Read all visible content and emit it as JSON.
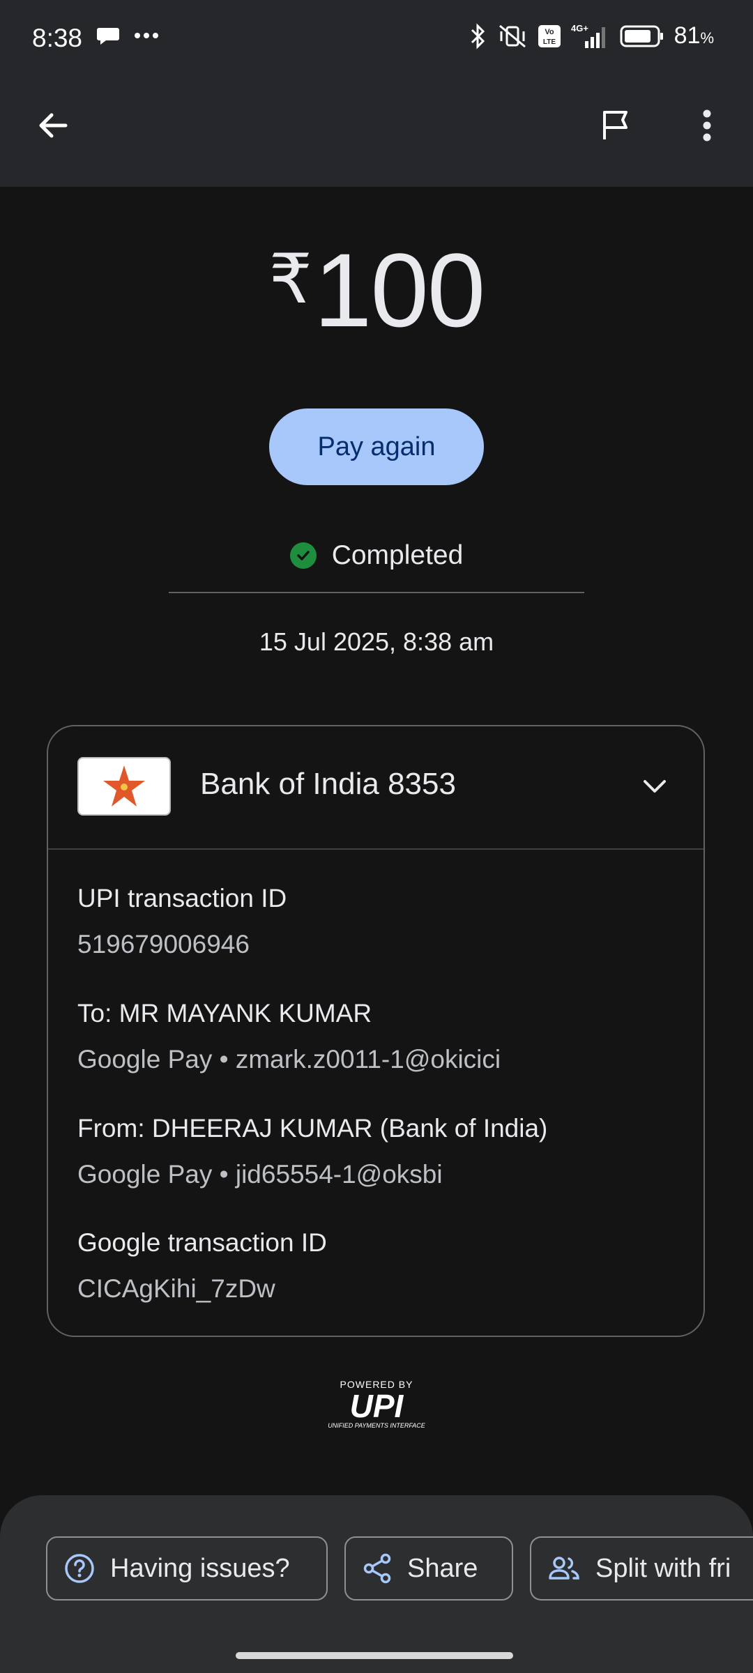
{
  "status_bar": {
    "time": "8:38",
    "battery_percent": "81",
    "battery_unit": "%",
    "network": "4G+",
    "volte": "Vo LTE"
  },
  "header": {
    "back_icon": "arrow-back-icon",
    "flag_icon": "flag-icon",
    "more_icon": "more-vert-icon"
  },
  "transaction": {
    "currency_symbol": "₹",
    "amount": "100",
    "pay_again_label": "Pay again",
    "status": "Completed",
    "datetime": "15 Jul 2025, 8:38 am"
  },
  "details_card": {
    "bank_name": "Bank of India 8353",
    "fields": [
      {
        "label": "UPI transaction ID",
        "value": "519679006946"
      },
      {
        "label": "To: MR MAYANK  KUMAR",
        "value": "Google Pay • zmark.z0011-1@okicici"
      },
      {
        "label": "From: DHEERAJ KUMAR (Bank of India)",
        "value": "Google Pay • jid65554-1@oksbi"
      },
      {
        "label": "Google transaction ID",
        "value": "CICAgKihi_7zDw"
      }
    ]
  },
  "upi_logo": {
    "powered_by": "POWERED BY",
    "wordmark": "UPI",
    "subtitle": "UNIFIED PAYMENTS INTERFACE"
  },
  "actions": [
    {
      "label": "Having issues?",
      "icon": "help-icon"
    },
    {
      "label": "Share",
      "icon": "share-icon"
    },
    {
      "label": "Split with fri",
      "icon": "group-icon"
    }
  ],
  "colors": {
    "accent": "#a8c7fa",
    "success": "#1e8e3e",
    "background": "#141414"
  }
}
